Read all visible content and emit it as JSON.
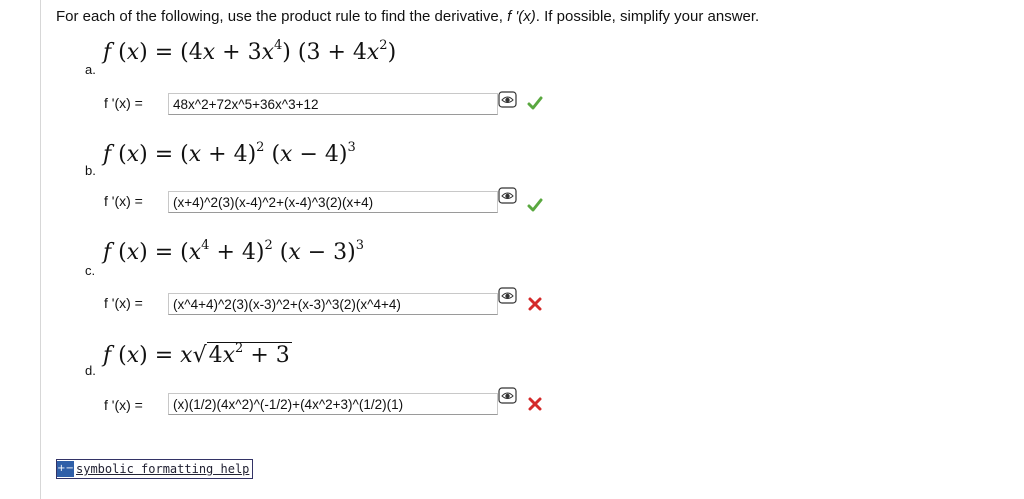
{
  "instruction": {
    "text_before": "For each of the following, use the product rule to find the derivative, ",
    "fprime": "f '(x)",
    "text_after": ". If possible, simplify your answer."
  },
  "problems": [
    {
      "letter": "a.",
      "label": "f '(x) =",
      "answer": "48x^2+72x^5+36x^3+12",
      "status": "correct"
    },
    {
      "letter": "b.",
      "label": "f '(x) =",
      "answer": "(x+4)^2(3)(x-4)^2+(x-4)^3(2)(x+4)",
      "status": "correct"
    },
    {
      "letter": "c.",
      "label": "f '(x) =",
      "answer": "(x^4+4)^2(3)(x-3)^2+(x-3)^3(2)(x^4+4)",
      "status": "incorrect"
    },
    {
      "letter": "d.",
      "label": "f '(x) =",
      "answer": "(x)(1/2)(4x^2)^(-1/2)+(4x^2+3)^(1/2)(1)",
      "status": "incorrect"
    }
  ],
  "help_link": {
    "label": "symbolic formatting help"
  },
  "colors": {
    "correct": "#5aa840",
    "incorrect": "#d42a2a",
    "help_icon": "#2f5fa8"
  },
  "icons": {
    "preview": "eye-preview-icon",
    "correct": "checkmark-icon",
    "incorrect": "x-mark-icon"
  }
}
